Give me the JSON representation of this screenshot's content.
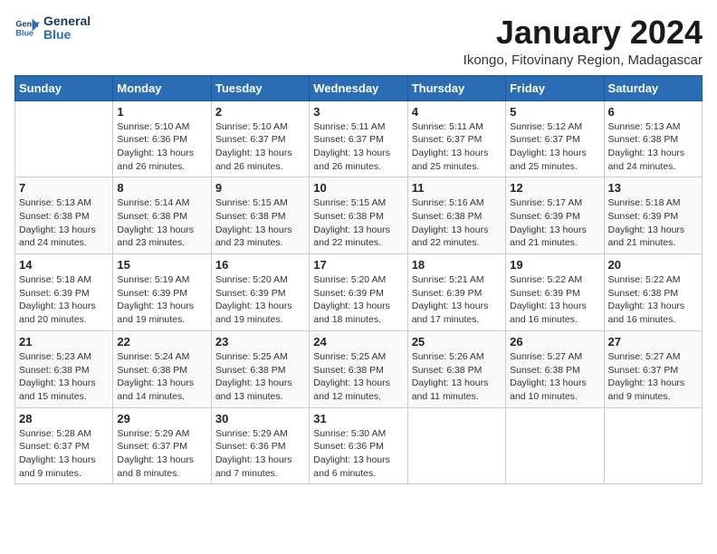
{
  "logo": {
    "line1": "General",
    "line2": "Blue"
  },
  "title": "January 2024",
  "location": "Ikongo, Fitovinany Region, Madagascar",
  "headers": [
    "Sunday",
    "Monday",
    "Tuesday",
    "Wednesday",
    "Thursday",
    "Friday",
    "Saturday"
  ],
  "weeks": [
    [
      {
        "day": "",
        "info": ""
      },
      {
        "day": "1",
        "info": "Sunrise: 5:10 AM\nSunset: 6:36 PM\nDaylight: 13 hours\nand 26 minutes."
      },
      {
        "day": "2",
        "info": "Sunrise: 5:10 AM\nSunset: 6:37 PM\nDaylight: 13 hours\nand 26 minutes."
      },
      {
        "day": "3",
        "info": "Sunrise: 5:11 AM\nSunset: 6:37 PM\nDaylight: 13 hours\nand 26 minutes."
      },
      {
        "day": "4",
        "info": "Sunrise: 5:11 AM\nSunset: 6:37 PM\nDaylight: 13 hours\nand 25 minutes."
      },
      {
        "day": "5",
        "info": "Sunrise: 5:12 AM\nSunset: 6:37 PM\nDaylight: 13 hours\nand 25 minutes."
      },
      {
        "day": "6",
        "info": "Sunrise: 5:13 AM\nSunset: 6:38 PM\nDaylight: 13 hours\nand 24 minutes."
      }
    ],
    [
      {
        "day": "7",
        "info": "Sunrise: 5:13 AM\nSunset: 6:38 PM\nDaylight: 13 hours\nand 24 minutes."
      },
      {
        "day": "8",
        "info": "Sunrise: 5:14 AM\nSunset: 6:38 PM\nDaylight: 13 hours\nand 23 minutes."
      },
      {
        "day": "9",
        "info": "Sunrise: 5:15 AM\nSunset: 6:38 PM\nDaylight: 13 hours\nand 23 minutes."
      },
      {
        "day": "10",
        "info": "Sunrise: 5:15 AM\nSunset: 6:38 PM\nDaylight: 13 hours\nand 22 minutes."
      },
      {
        "day": "11",
        "info": "Sunrise: 5:16 AM\nSunset: 6:38 PM\nDaylight: 13 hours\nand 22 minutes."
      },
      {
        "day": "12",
        "info": "Sunrise: 5:17 AM\nSunset: 6:39 PM\nDaylight: 13 hours\nand 21 minutes."
      },
      {
        "day": "13",
        "info": "Sunrise: 5:18 AM\nSunset: 6:39 PM\nDaylight: 13 hours\nand 21 minutes."
      }
    ],
    [
      {
        "day": "14",
        "info": "Sunrise: 5:18 AM\nSunset: 6:39 PM\nDaylight: 13 hours\nand 20 minutes."
      },
      {
        "day": "15",
        "info": "Sunrise: 5:19 AM\nSunset: 6:39 PM\nDaylight: 13 hours\nand 19 minutes."
      },
      {
        "day": "16",
        "info": "Sunrise: 5:20 AM\nSunset: 6:39 PM\nDaylight: 13 hours\nand 19 minutes."
      },
      {
        "day": "17",
        "info": "Sunrise: 5:20 AM\nSunset: 6:39 PM\nDaylight: 13 hours\nand 18 minutes."
      },
      {
        "day": "18",
        "info": "Sunrise: 5:21 AM\nSunset: 6:39 PM\nDaylight: 13 hours\nand 17 minutes."
      },
      {
        "day": "19",
        "info": "Sunrise: 5:22 AM\nSunset: 6:39 PM\nDaylight: 13 hours\nand 16 minutes."
      },
      {
        "day": "20",
        "info": "Sunrise: 5:22 AM\nSunset: 6:38 PM\nDaylight: 13 hours\nand 16 minutes."
      }
    ],
    [
      {
        "day": "21",
        "info": "Sunrise: 5:23 AM\nSunset: 6:38 PM\nDaylight: 13 hours\nand 15 minutes."
      },
      {
        "day": "22",
        "info": "Sunrise: 5:24 AM\nSunset: 6:38 PM\nDaylight: 13 hours\nand 14 minutes."
      },
      {
        "day": "23",
        "info": "Sunrise: 5:25 AM\nSunset: 6:38 PM\nDaylight: 13 hours\nand 13 minutes."
      },
      {
        "day": "24",
        "info": "Sunrise: 5:25 AM\nSunset: 6:38 PM\nDaylight: 13 hours\nand 12 minutes."
      },
      {
        "day": "25",
        "info": "Sunrise: 5:26 AM\nSunset: 6:38 PM\nDaylight: 13 hours\nand 11 minutes."
      },
      {
        "day": "26",
        "info": "Sunrise: 5:27 AM\nSunset: 6:38 PM\nDaylight: 13 hours\nand 10 minutes."
      },
      {
        "day": "27",
        "info": "Sunrise: 5:27 AM\nSunset: 6:37 PM\nDaylight: 13 hours\nand 9 minutes."
      }
    ],
    [
      {
        "day": "28",
        "info": "Sunrise: 5:28 AM\nSunset: 6:37 PM\nDaylight: 13 hours\nand 9 minutes."
      },
      {
        "day": "29",
        "info": "Sunrise: 5:29 AM\nSunset: 6:37 PM\nDaylight: 13 hours\nand 8 minutes."
      },
      {
        "day": "30",
        "info": "Sunrise: 5:29 AM\nSunset: 6:36 PM\nDaylight: 13 hours\nand 7 minutes."
      },
      {
        "day": "31",
        "info": "Sunrise: 5:30 AM\nSunset: 6:36 PM\nDaylight: 13 hours\nand 6 minutes."
      },
      {
        "day": "",
        "info": ""
      },
      {
        "day": "",
        "info": ""
      },
      {
        "day": "",
        "info": ""
      }
    ]
  ]
}
